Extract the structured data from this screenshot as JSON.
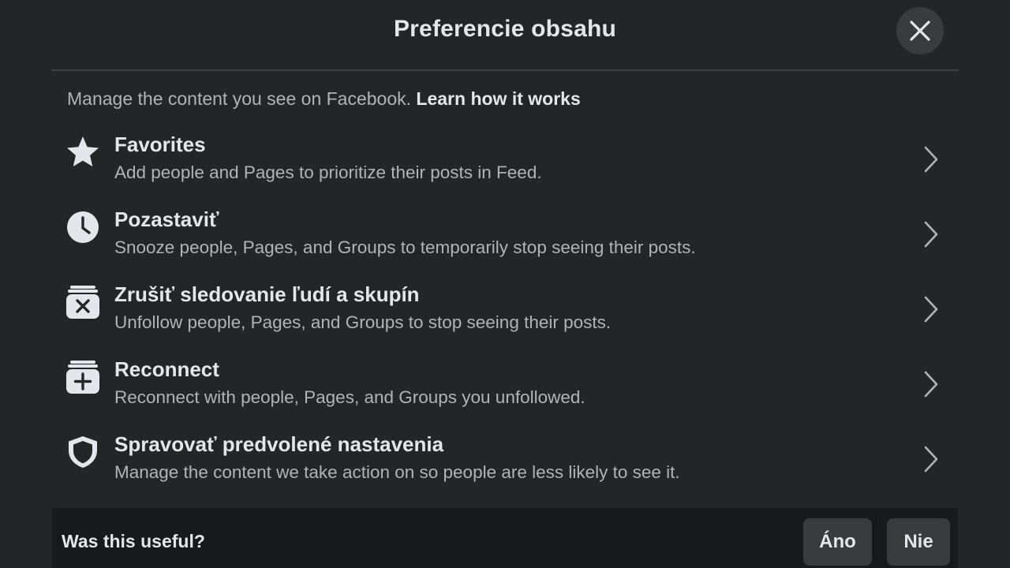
{
  "header": {
    "title": "Preferencie obsahu",
    "close_icon": "close-icon"
  },
  "intro": {
    "text": "Manage the content you see on Facebook.",
    "link": "Learn how it works"
  },
  "items": [
    {
      "icon": "star-icon",
      "label": "Favorites",
      "description": "Add people and Pages to prioritize their posts in Feed."
    },
    {
      "icon": "clock-icon",
      "label": "Pozastaviť",
      "description": "Snooze people, Pages, and Groups to temporarily stop seeing their posts."
    },
    {
      "icon": "unfollow-icon",
      "label": "Zrušiť sledovanie ľudí a skupín",
      "description": "Unfollow people, Pages, and Groups to stop seeing their posts."
    },
    {
      "icon": "reconnect-icon",
      "label": "Reconnect",
      "description": "Reconnect with people, Pages, and Groups you unfollowed."
    },
    {
      "icon": "shield-icon",
      "label": "Spravovať predvolené nastavenia",
      "description": "Manage the content we take action on so people are less likely to see it."
    }
  ],
  "footer": {
    "question": "Was this useful?",
    "yes_label": "Áno",
    "no_label": "Nie"
  },
  "colors": {
    "background": "#242526",
    "surface": "#3a3b3c",
    "footer_background": "#18191a",
    "primary_text": "#e4e6eb",
    "secondary_text": "#b0b3b8"
  }
}
